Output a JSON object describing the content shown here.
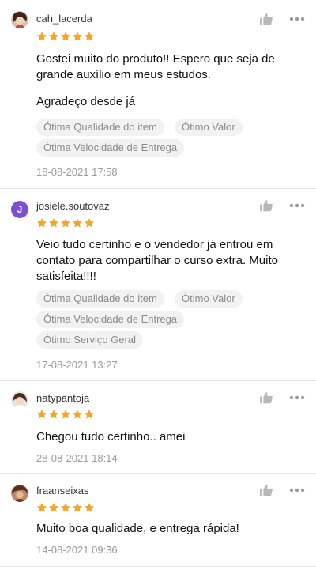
{
  "colors": {
    "star": "#f5a623",
    "tag_bg": "#f2f2f2",
    "tag_text": "#8a8a8a",
    "date": "#9a9a9a"
  },
  "reviews": [
    {
      "username": "cah_lacerda",
      "rating": 5,
      "comment_lines": [
        "Gostei muito do produto!! Espero que seja de",
        "grande auxílio em meus estudos.",
        "",
        "Agradeço desde já"
      ],
      "tags": [
        "Ótima Qualidade do item",
        "Ótimo Valor",
        "Ótima Velocidade de Entrega"
      ],
      "date": "18-08-2021 17:58"
    },
    {
      "username": "josiele.soutovaz",
      "avatar_letter": "J",
      "rating": 5,
      "comment_lines": [
        "Veio tudo certinho e o vendedor já entrou em",
        "contato para compartilhar o curso extra. Muito",
        "satisfeita!!!!"
      ],
      "tags": [
        "Ótima Qualidade do item",
        "Ótimo Valor",
        "Ótima Velocidade de Entrega",
        "Ótimo Serviço Geral"
      ],
      "date": "17-08-2021 13:27"
    },
    {
      "username": "natypantoja",
      "rating": 5,
      "comment_lines": [
        "Chegou tudo certinho.. amei"
      ],
      "tags": [],
      "date": "28-08-2021 18:14"
    },
    {
      "username": "fraanseixas",
      "rating": 5,
      "comment_lines": [
        "Muito boa qualidade, e entrega rápida!"
      ],
      "tags": [],
      "date": "14-08-2021 09:36"
    }
  ]
}
